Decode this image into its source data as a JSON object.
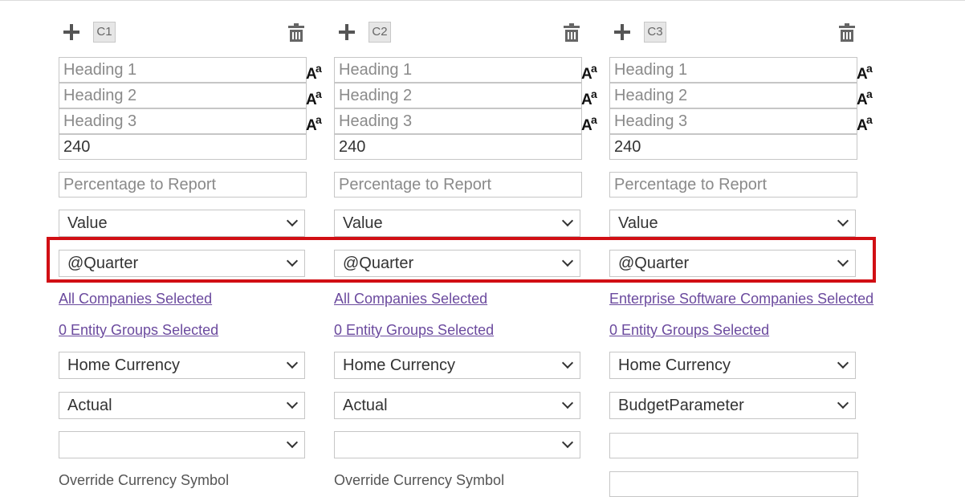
{
  "columns": [
    {
      "code": "C1",
      "headings": [
        "Heading 1",
        "Heading 2",
        "Heading 3"
      ],
      "width_value": "240",
      "percentage_placeholder": "Percentage to Report",
      "value_select": "Value",
      "period_select": "@Quarter",
      "companies_link": "All Companies Selected",
      "entity_groups_link": "0 Entity Groups Selected",
      "currency_select": "Home Currency",
      "scenario_select": "Actual",
      "extra_select": "",
      "override_label": "Override Currency Symbol"
    },
    {
      "code": "C2",
      "headings": [
        "Heading 1",
        "Heading 2",
        "Heading 3"
      ],
      "width_value": "240",
      "percentage_placeholder": "Percentage to Report",
      "value_select": "Value",
      "period_select": "@Quarter",
      "companies_link": "All Companies Selected",
      "entity_groups_link": "0 Entity Groups Selected",
      "currency_select": "Home Currency",
      "scenario_select": "Actual",
      "extra_select": "",
      "override_label": "Override Currency Symbol"
    },
    {
      "code": "C3",
      "headings": [
        "Heading 1",
        "Heading 2",
        "Heading 3"
      ],
      "width_value": "240",
      "percentage_placeholder": "Percentage to Report",
      "value_select": "Value",
      "period_select": "@Quarter",
      "companies_link": "Enterprise Software Companies Selected",
      "entity_groups_link": "0 Entity Groups Selected",
      "currency_select": "Home Currency",
      "scenario_select": "BudgetParameter",
      "extra_input": ""
    }
  ],
  "colors": {
    "highlight": "#d10f14",
    "link": "#6b4a9e",
    "border": "#c6c6c6",
    "placeholder": "#8a8a8a"
  },
  "icons": [
    "plus-icon",
    "trash-icon",
    "font-size-icon",
    "chevron-down-icon"
  ]
}
